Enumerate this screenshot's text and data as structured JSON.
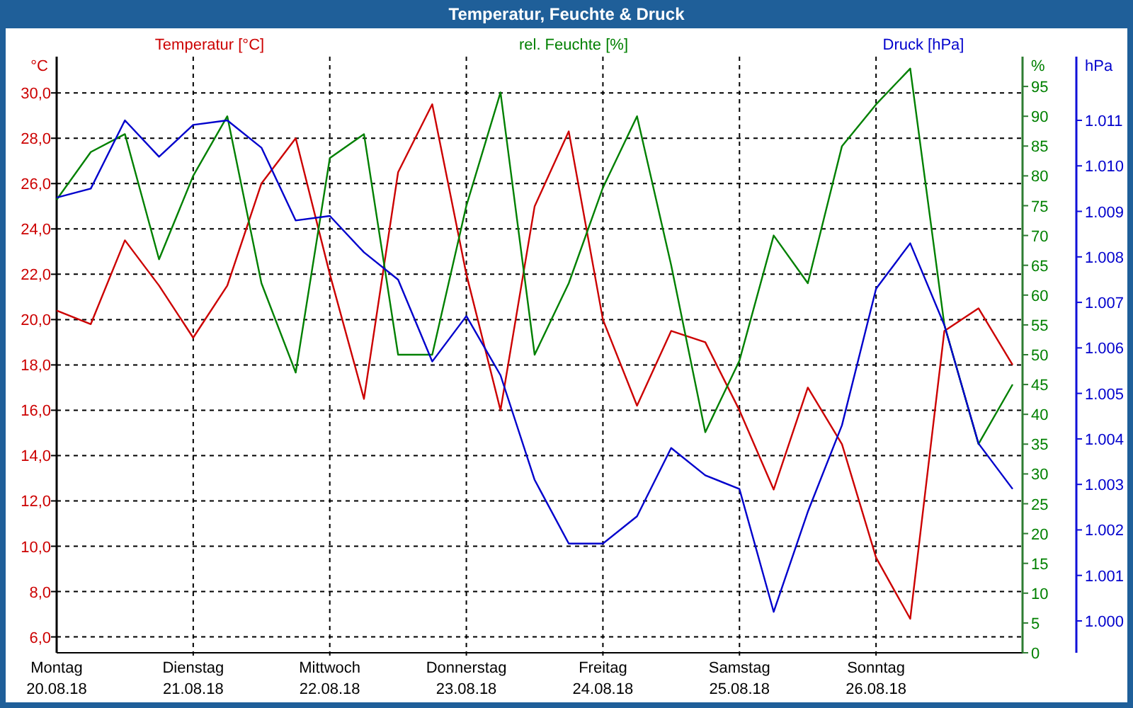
{
  "window": {
    "title": "Temperatur, Feuchte & Druck"
  },
  "charts": [
    {
      "chart_data": {
        "type": "line",
        "ylabel": "°C",
        "categories": [
          "Montag 20.08.18",
          null,
          null,
          null,
          "Dienstag 21.08.18",
          null,
          null,
          null,
          "Mittwoch 22.08.18",
          null,
          null,
          null,
          "Donnerstag 23.08.18",
          null,
          null,
          null,
          "Freitag 24.08.18",
          null,
          null,
          null,
          "Samstag 25.08.18",
          null,
          null,
          null,
          "Sonntag 26.08.18",
          null,
          null,
          null,
          null
        ],
        "ylim": [
          5.3,
          31.6
        ],
        "yticks": [
          {
            "value": 30,
            "label": "30,0"
          },
          {
            "value": 28,
            "label": "28,0"
          },
          {
            "value": 26,
            "label": "26,0"
          },
          {
            "value": 24,
            "label": "24,0"
          },
          {
            "value": 22,
            "label": "22,0"
          },
          {
            "value": 20,
            "label": "20,0"
          },
          {
            "value": 18,
            "label": "18,0"
          },
          {
            "value": 16,
            "label": "16,0"
          },
          {
            "value": 14,
            "label": "14,0"
          },
          {
            "value": 12,
            "label": "12,0"
          },
          {
            "value": 10,
            "label": "10,0"
          },
          {
            "value": 8,
            "label": "8,0"
          },
          {
            "value": 6,
            "label": "6,0"
          }
        ],
        "series": [
          {
            "name": "Temperatur [°C]",
            "color": "#cc0000",
            "values": [
              20.4,
              19.8,
              23.5,
              21.5,
              19.2,
              21.5,
              26.0,
              28.0,
              22.0,
              16.5,
              26.5,
              29.5,
              22.0,
              16.0,
              25.0,
              28.3,
              20.0,
              16.2,
              19.5,
              19.0,
              16.0,
              12.5,
              17.0,
              14.5,
              9.5,
              6.8,
              19.5,
              20.5,
              18.0
            ]
          }
        ]
      }
    },
    {
      "chart_data": {
        "type": "line",
        "ylabel": "%",
        "categories": [
          null,
          null,
          null,
          null,
          null,
          null,
          null,
          null,
          null,
          null,
          null,
          null,
          null,
          null,
          null,
          null,
          null,
          null,
          null,
          null,
          null,
          null,
          null,
          null,
          null,
          null,
          null,
          null,
          null
        ],
        "ylim": [
          0,
          100
        ],
        "yticks": [
          {
            "value": 95,
            "label": "95"
          },
          {
            "value": 90,
            "label": "90"
          },
          {
            "value": 85,
            "label": "85"
          },
          {
            "value": 80,
            "label": "80"
          },
          {
            "value": 75,
            "label": "75"
          },
          {
            "value": 70,
            "label": "70"
          },
          {
            "value": 65,
            "label": "65"
          },
          {
            "value": 60,
            "label": "60"
          },
          {
            "value": 55,
            "label": "55"
          },
          {
            "value": 50,
            "label": "50"
          },
          {
            "value": 45,
            "label": "45"
          },
          {
            "value": 40,
            "label": "40"
          },
          {
            "value": 35,
            "label": "35"
          },
          {
            "value": 30,
            "label": "30"
          },
          {
            "value": 25,
            "label": "25"
          },
          {
            "value": 20,
            "label": "20"
          },
          {
            "value": 15,
            "label": "15"
          },
          {
            "value": 10,
            "label": "10"
          },
          {
            "value": 5,
            "label": "5"
          },
          {
            "value": 0,
            "label": "0"
          }
        ],
        "series": [
          {
            "name": "rel. Feuchte [%]",
            "color": "#008000",
            "values": [
              76,
              84,
              87,
              66,
              80,
              90,
              62,
              47,
              83,
              87,
              50,
              50,
              75,
              94,
              50,
              62,
              78,
              90,
              65,
              37,
              49,
              70,
              62,
              85,
              92,
              98,
              55,
              35,
              45
            ]
          }
        ]
      }
    },
    {
      "chart_data": {
        "type": "line",
        "ylabel": "hPa",
        "categories": [
          null,
          null,
          null,
          null,
          null,
          null,
          null,
          null,
          null,
          null,
          null,
          null,
          null,
          null,
          null,
          null,
          null,
          null,
          null,
          null,
          null,
          null,
          null,
          null,
          null,
          null,
          null,
          null,
          null
        ],
        "ylim": [
          999.3,
          1012.4
        ],
        "yticks": [
          {
            "value": 1011,
            "label": "1.011"
          },
          {
            "value": 1010,
            "label": "1.010"
          },
          {
            "value": 1009,
            "label": "1.009"
          },
          {
            "value": 1008,
            "label": "1.008"
          },
          {
            "value": 1007,
            "label": "1.007"
          },
          {
            "value": 1006,
            "label": "1.006"
          },
          {
            "value": 1005,
            "label": "1.005"
          },
          {
            "value": 1004,
            "label": "1.004"
          },
          {
            "value": 1003,
            "label": "1.003"
          },
          {
            "value": 1002,
            "label": "1.002"
          },
          {
            "value": 1001,
            "label": "1.001"
          },
          {
            "value": 1000,
            "label": "1.000"
          }
        ],
        "series": [
          {
            "name": "Druck [hPa]",
            "color": "#0000cc",
            "values": [
              1009.3,
              1009.5,
              1011.0,
              1010.2,
              1010.9,
              1011.0,
              1010.4,
              1008.8,
              1008.9,
              1008.1,
              1007.5,
              1005.7,
              1006.7,
              1005.4,
              1003.1,
              1001.7,
              1001.7,
              1002.3,
              1003.8,
              1003.2,
              1002.9,
              1000.2,
              1002.4,
              1004.3,
              1007.3,
              1008.3,
              1006.5,
              1003.9,
              1002.9
            ]
          }
        ]
      }
    }
  ]
}
